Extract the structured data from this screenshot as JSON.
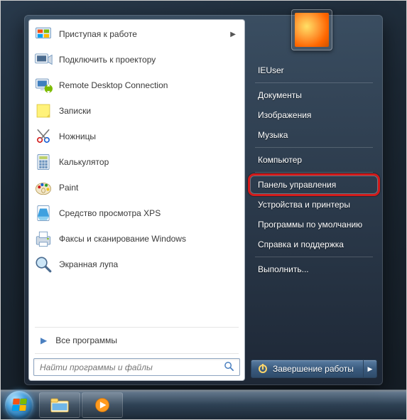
{
  "left": {
    "programs": [
      {
        "label": "Приступая к работе",
        "icon": "getting-started",
        "submenu": true
      },
      {
        "label": "Подключить к проектору",
        "icon": "projector"
      },
      {
        "label": "Remote Desktop Connection",
        "icon": "rdp"
      },
      {
        "label": "Записки",
        "icon": "stickynotes"
      },
      {
        "label": "Ножницы",
        "icon": "snipping"
      },
      {
        "label": "Калькулятор",
        "icon": "calculator"
      },
      {
        "label": "Paint",
        "icon": "paint"
      },
      {
        "label": "Средство просмотра XPS",
        "icon": "xps"
      },
      {
        "label": "Факсы и сканирование Windows",
        "icon": "fax"
      },
      {
        "label": "Экранная лупа",
        "icon": "magnifier"
      }
    ],
    "all_programs": "Все программы",
    "search_placeholder": "Найти программы и файлы"
  },
  "right": {
    "user": "IEUser",
    "items_top": [
      "Документы",
      "Изображения",
      "Музыка"
    ],
    "items_mid": [
      "Компьютер"
    ],
    "items_sys": [
      "Панель управления",
      "Устройства и принтеры",
      "Программы по умолчанию",
      "Справка и поддержка"
    ],
    "items_bot": [
      "Выполнить..."
    ],
    "highlighted_index": 0,
    "shutdown_label": "Завершение работы"
  },
  "colors": {
    "highlight_ring": "#d21a1a"
  }
}
